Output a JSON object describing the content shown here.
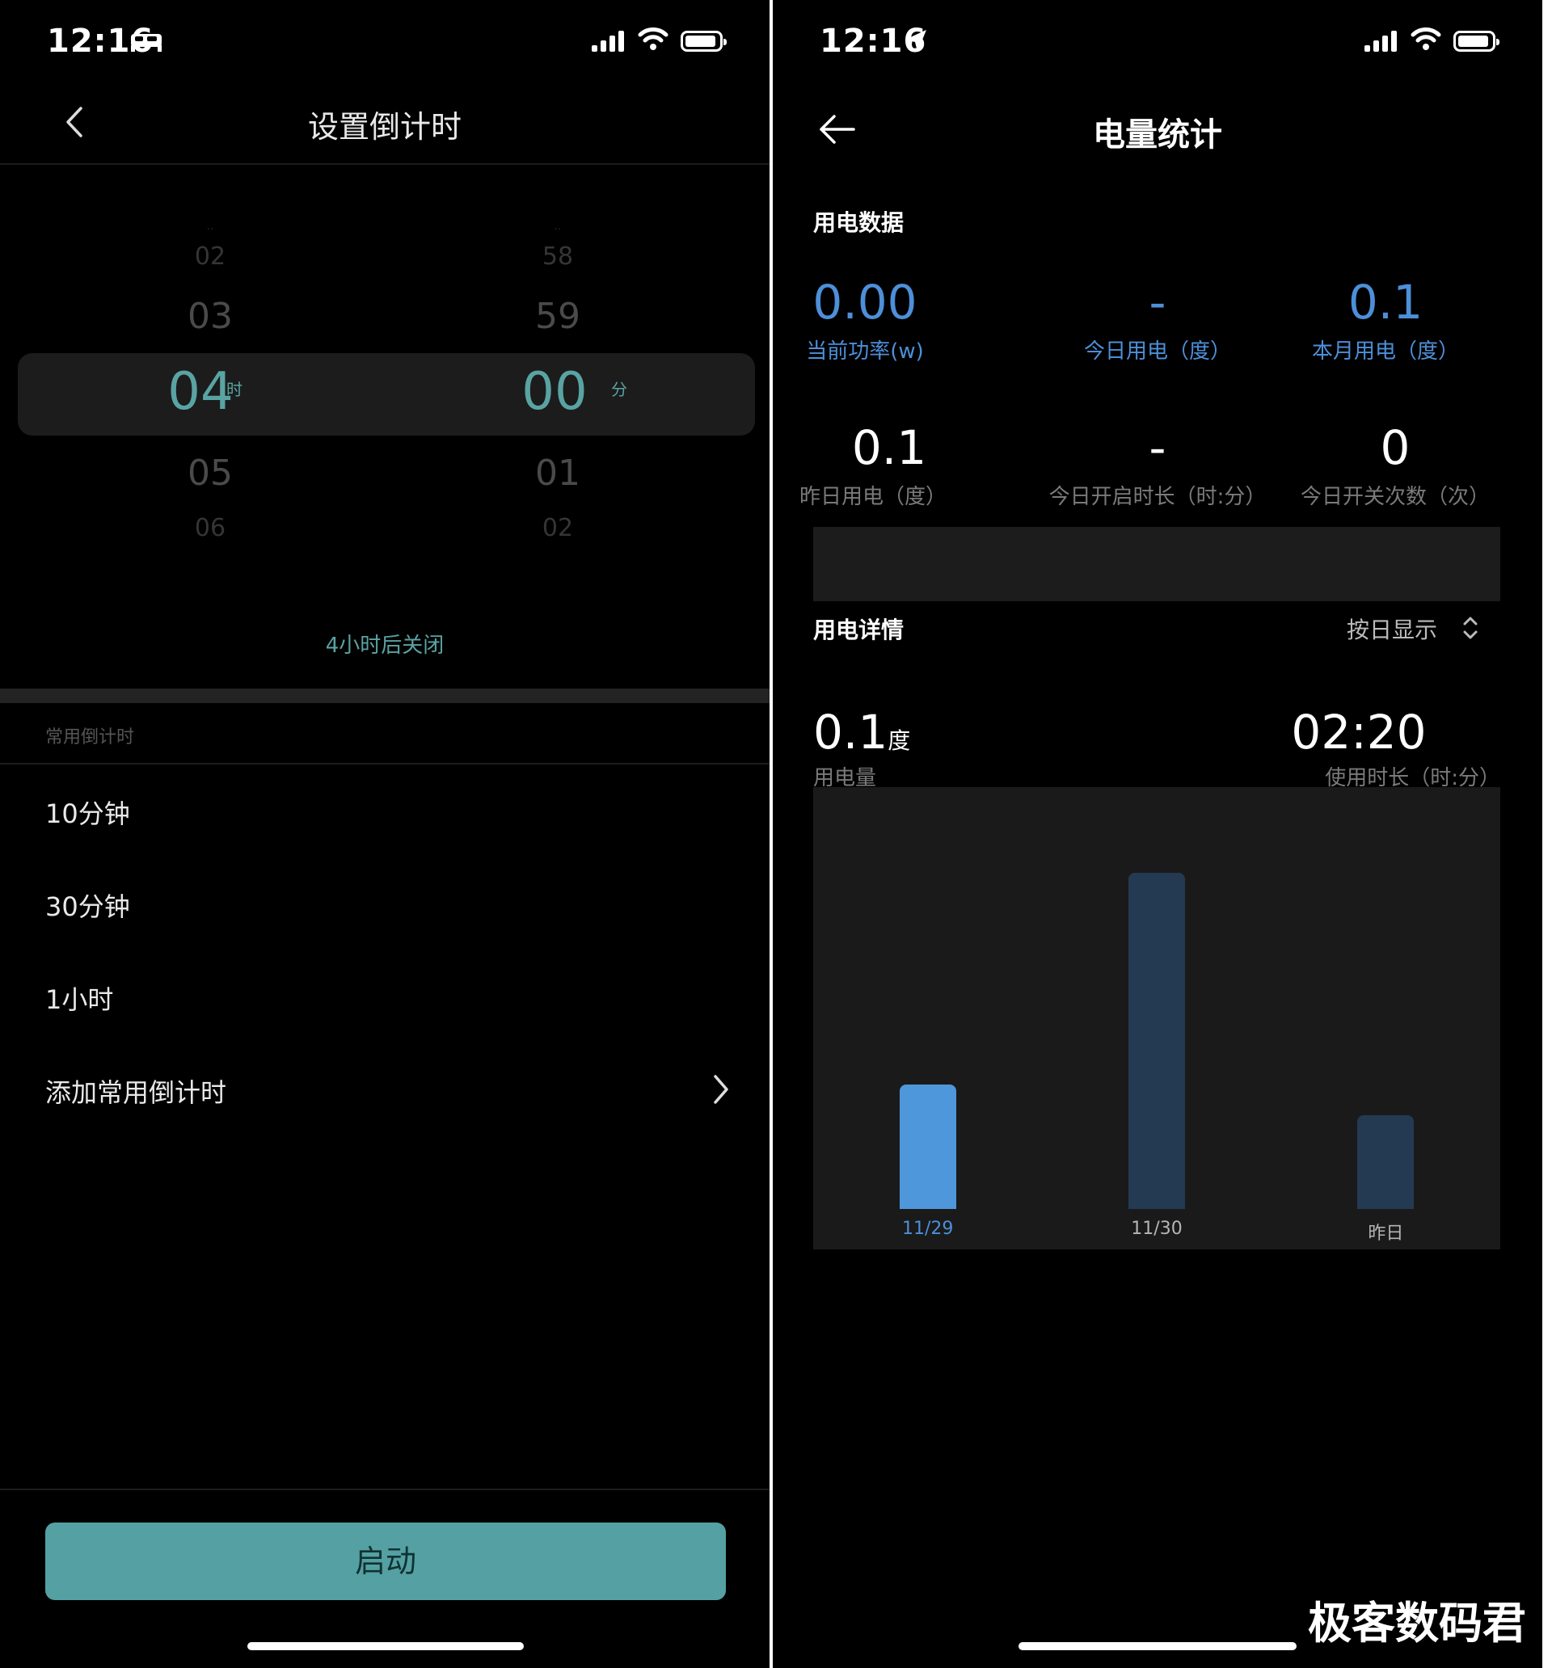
{
  "left": {
    "status": {
      "time": "12:16"
    },
    "header": {
      "title": "设置倒计时"
    },
    "picker": {
      "hours": {
        "far_above": "02",
        "above": "03",
        "selected": "04",
        "unit": "时",
        "below": "05",
        "far_below": "06"
      },
      "minutes": {
        "far_above": "58",
        "above": "59",
        "selected": "00",
        "unit": "分",
        "below": "01",
        "far_below": "02"
      }
    },
    "hint": "4小时后关闭",
    "section_label": "常用倒计时",
    "presets": [
      "10分钟",
      "30分钟",
      "1小时"
    ],
    "add_preset": "添加常用倒计时",
    "start_button": "启动",
    "colors": {
      "accent": "#54a0a3"
    }
  },
  "right": {
    "status": {
      "time": "12:16"
    },
    "header": {
      "title": "电量统计"
    },
    "usage_section": "用电数据",
    "metrics_row1": [
      {
        "value": "0.00",
        "label": "当前功率(w)"
      },
      {
        "value": "-",
        "label": "今日用电（度）"
      },
      {
        "value": "0.1",
        "label": "本月用电（度）"
      }
    ],
    "metrics_row2": [
      {
        "value": "0.1",
        "label": "昨日用电（度）"
      },
      {
        "value": "-",
        "label": "今日开启时长（时:分）"
      },
      {
        "value": "0",
        "label": "今日开关次数（次）"
      }
    ],
    "detail_section": "用电详情",
    "display_mode": "按日显示",
    "summary": {
      "energy_value": "0.1",
      "energy_unit": "度",
      "energy_label": "用电量",
      "duration_value": "02:20",
      "duration_label": "使用时长（时:分）"
    },
    "colors": {
      "highlight": "#4d8fd9",
      "bar_selected": "#4f97db",
      "bar_default": "#243a52"
    }
  },
  "chart_data": {
    "type": "bar",
    "categories": [
      "11/29",
      "11/30",
      "昨日"
    ],
    "values": [
      0.37,
      1.0,
      0.28
    ],
    "selected_index": 0,
    "ylim": [
      0,
      1
    ],
    "grid": false
  },
  "watermark": "极客数码君"
}
